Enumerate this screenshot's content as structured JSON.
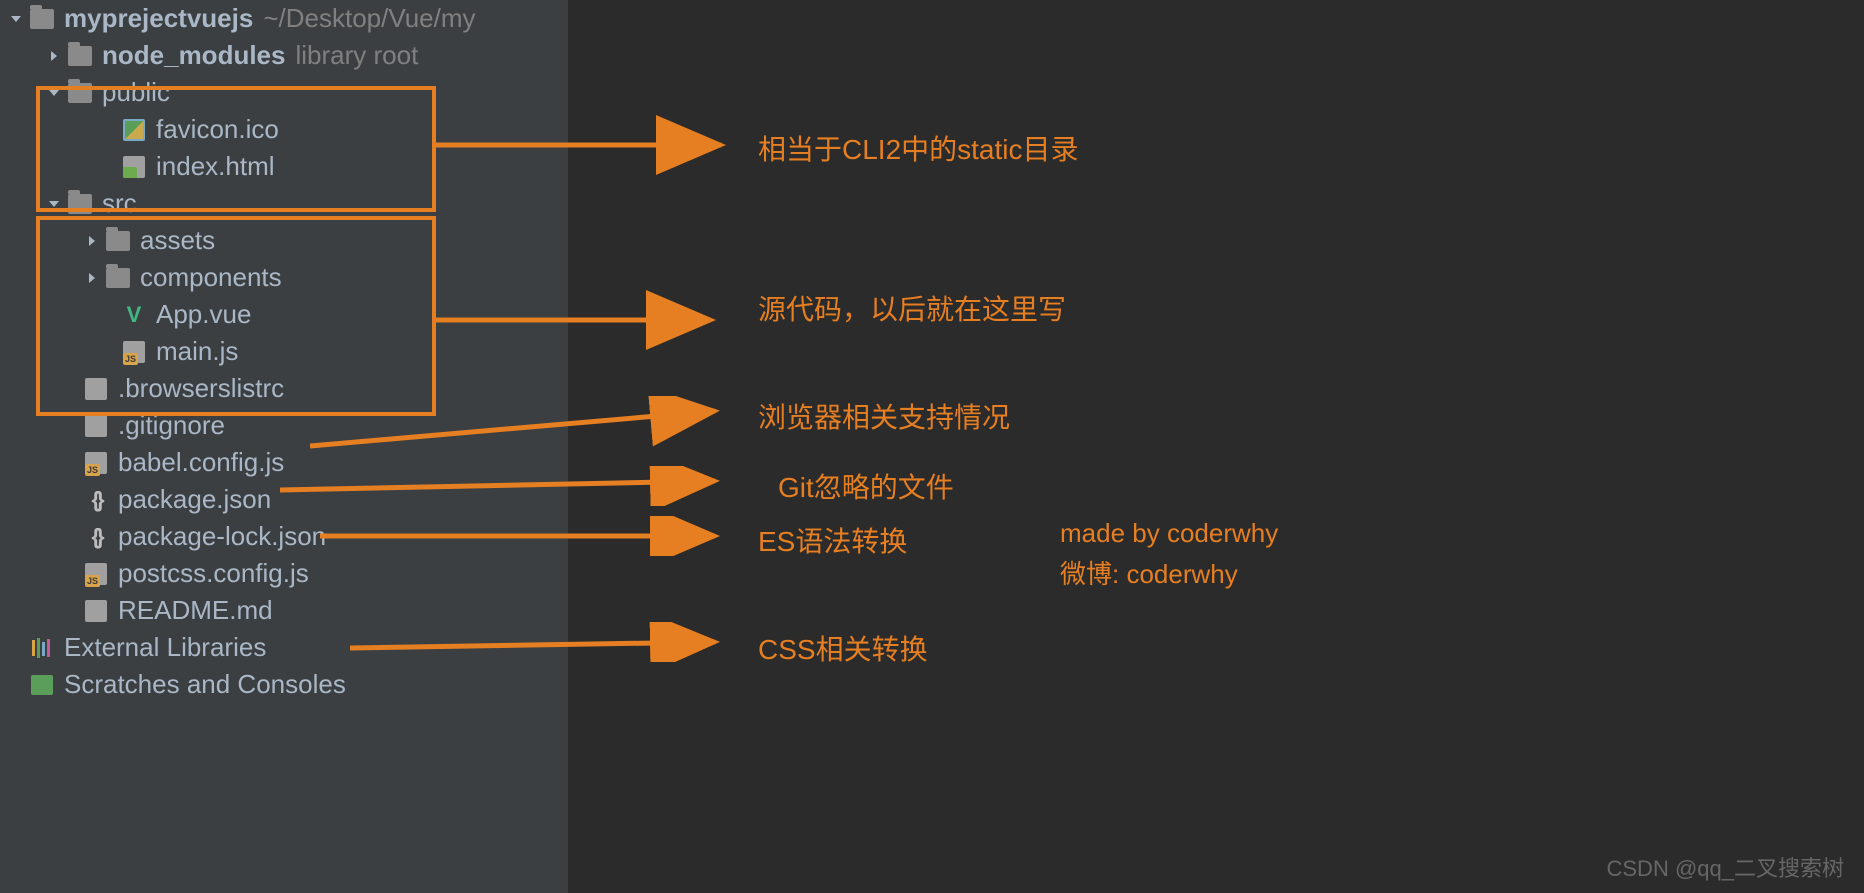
{
  "project": {
    "name": "myprejectvuejs",
    "path": "~/Desktop/Vue/my"
  },
  "tree": {
    "node_modules": {
      "label": "node_modules",
      "hint": "library root"
    },
    "public": {
      "label": "public",
      "favicon": "favicon.ico",
      "index": "index.html"
    },
    "src": {
      "label": "src",
      "assets": "assets",
      "components": "components",
      "app": "App.vue",
      "main": "main.js"
    },
    "files": {
      "browserslist": ".browserslistrc",
      "gitignore": ".gitignore",
      "babel": "babel.config.js",
      "pkg": "package.json",
      "pkglock": "package-lock.json",
      "postcss": "postcss.config.js",
      "readme": "README.md"
    },
    "external": "External Libraries",
    "scratches": "Scratches and Consoles"
  },
  "annotations": {
    "public": "相当于CLI2中的static目录",
    "src": "源代码，以后就在这里写",
    "browserslist": "浏览器相关支持情况",
    "gitignore": "Git忽略的文件",
    "babel": "ES语法转换",
    "postcss": "CSS相关转换"
  },
  "credit": {
    "line1": "made by coderwhy",
    "line2": "微博: coderwhy"
  },
  "watermark": "CSDN @qq_二叉搜索树"
}
